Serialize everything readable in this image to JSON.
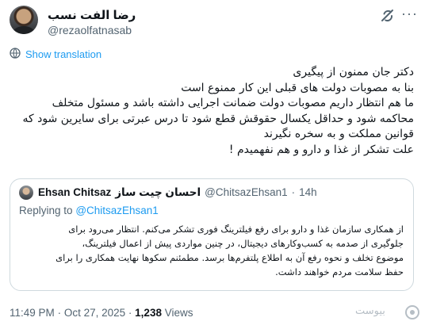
{
  "author": {
    "display_name": "رضا الفت نسب",
    "handle": "@rezaolfatnasab"
  },
  "header": {
    "grok_icon": "grok-icon",
    "more_icon": "more-icon",
    "more_glyph": "···"
  },
  "translation": {
    "label": "Show translation",
    "icon": "translate-icon"
  },
  "tweet_lines": [
    "دکتر جان ممنون از پیگیری",
    "بنا به مصوبات دولت های قبلی این کار ممنوع است",
    "ما هم انتظار داریم مصوبات دولت ضمانت اجرایی داشته باشد و مسئول متخلف",
    "محاکمه شود و حداقل یکسال حقوقش قطع شود تا درس عبرتی برای سایرین شود که",
    "قوانین مملکت و به سخره نگیرند",
    "علت تشکر از غذا و دارو و هم نفهمیدم !"
  ],
  "quote": {
    "author_name_en": "Ehsan Chitsaz",
    "author_name_fa": "احسان چیت ساز",
    "handle": "@ChitsazEhsan1",
    "separator": "·",
    "time": "14h",
    "replying_prefix": "Replying to",
    "replying_to": "@ChitsazEhsan1",
    "lines": [
      "از همکاری سازمان غذا و دارو برای رفع فیلترینگ فوری تشکر می‌کنم. انتظار می‌رود برای",
      "جلوگیری از صدمه به کسب‌وکارهای دیجیتال، در چنین مواردی پیش از اعمال فیلترینگ،",
      "موضوع تخلف و نحوه رفع آن به اطلاع پلتفرم‌ها برسد. مطمئنم سکوها نهایت همکاری را برای",
      "حفظ سلامت مردم خواهند داشت."
    ]
  },
  "footer": {
    "time": "11:49 PM",
    "date": "Oct 27, 2025",
    "separator": "·",
    "views_count": "1,238",
    "views_label": "Views"
  },
  "watermark": {
    "label": "بیوست"
  },
  "colors": {
    "accent": "#1d9bf0",
    "secondary_text": "#536471",
    "border": "#cfd9de"
  }
}
